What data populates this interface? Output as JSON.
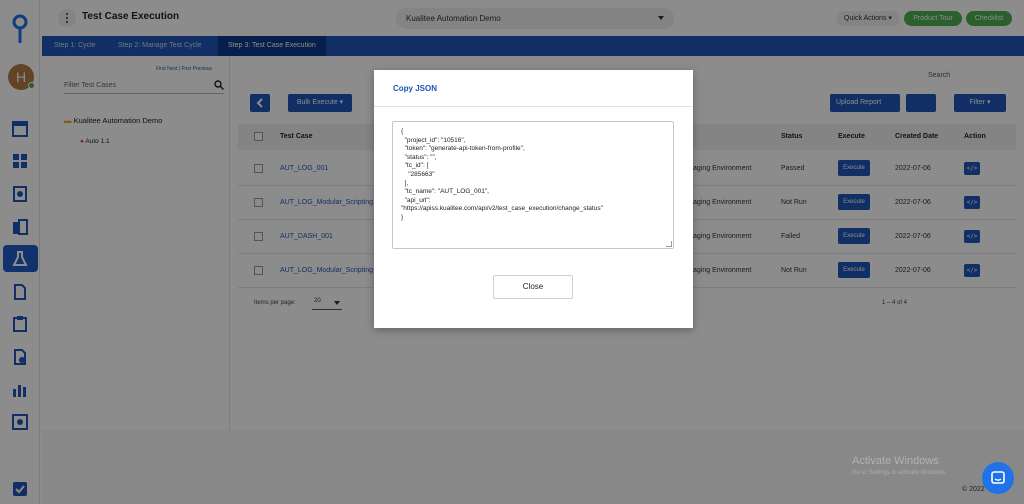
{
  "header": {
    "title": "Test Case Execution",
    "project": "Kualitee Automation Demo",
    "quick_actions": "Quick Actions",
    "product_tour": "Product Tour",
    "checklist": "Checklist"
  },
  "user": {
    "initial": "H"
  },
  "steps": [
    {
      "label": "Step 1: Cycle"
    },
    {
      "label": "Step 2: Manage Test Cycle"
    },
    {
      "label": "Step 3: Test Case Execution"
    }
  ],
  "tree": {
    "first_last": "First Next  |  First Previous",
    "filter_placeholder": "Filter Test Cases",
    "root": "Kualitee Automation Demo",
    "child": "Auto 1.1"
  },
  "toolbar": {
    "search": "Search",
    "bulk_execute": "Bulk Execute",
    "upload_report": "Upload Report",
    "filter": "Filter"
  },
  "table": {
    "headers": [
      "Test Case",
      "Status",
      "Execute",
      "Created Date",
      "Action"
    ],
    "rows": [
      {
        "name": "AUT_LOG_001",
        "env": "aging Environment",
        "status": "Passed",
        "execute": "Execute",
        "date": "2022-07-06",
        "action": "</>"
      },
      {
        "name": "AUT_LOG_Modular_Scripting",
        "env": "aging Environment",
        "status": "Not Run",
        "execute": "Execute",
        "date": "2022-07-06",
        "action": "</>"
      },
      {
        "name": "AUT_DASH_001",
        "env": "aging Environment",
        "status": "Failed",
        "execute": "Execute",
        "date": "2022-07-06",
        "action": "</>"
      },
      {
        "name": "AUT_LOG_Modular_Scripting",
        "env": "aging Environment",
        "status": "Not Run",
        "execute": "Execute",
        "date": "2022-07-06",
        "action": "</>"
      }
    ],
    "items_per_page_label": "Items per page:",
    "items_per_page_value": "20",
    "range": "1 – 4 of 4"
  },
  "modal": {
    "title": "Copy JSON",
    "json_lines": [
      "{",
      "  \"project_id\": \"10516\",",
      "  \"token\": \"generate-api-token-from-profile\",",
      "  \"status\": \"\",",
      "  \"tc_id\": [",
      "    \"285663\"",
      "  ],",
      "  \"tc_name\": \"AUT_LOG_001\",",
      "  \"api_url\":",
      "\"https://apiss.kualitee.com/api/v2/test_case_execution/change_status\"",
      "}"
    ],
    "close_label": "Close"
  },
  "footer": {
    "watermark_title": "Activate Windows",
    "watermark_sub": "Go to Settings to activate Windows.",
    "copyright": "© 2022"
  },
  "colors": {
    "primary": "#1f56b8",
    "green": "#4caf50",
    "overlay": "rgba(0,0,0,0.45)"
  }
}
